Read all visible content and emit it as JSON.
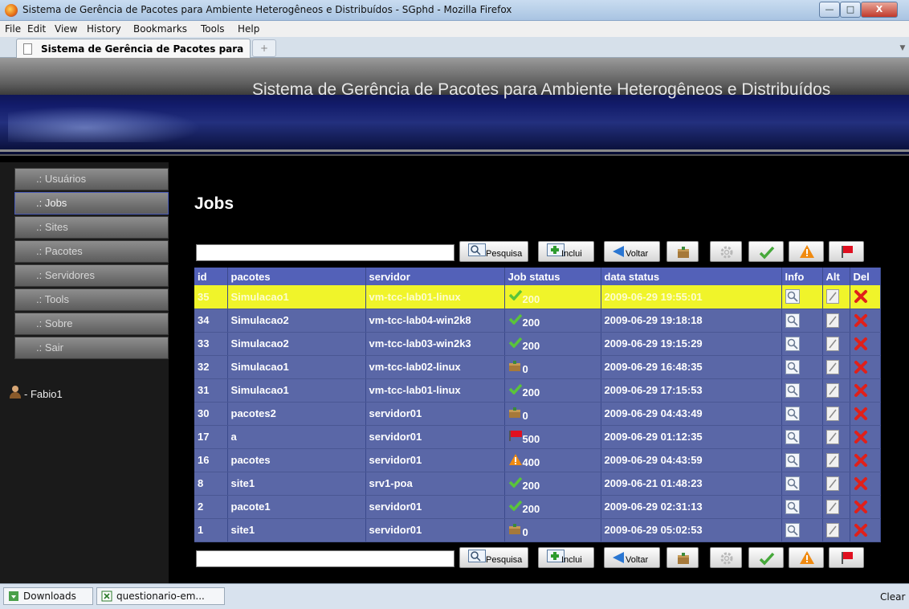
{
  "window": {
    "title": "Sistema de Gerência de Pacotes para Ambiente Heterogêneos e Distribuídos - SGphd - Mozilla Firefox"
  },
  "menu": [
    "File",
    "Edit",
    "View",
    "History",
    "Bookmarks",
    "Tools",
    "Help"
  ],
  "tab": {
    "label": "Sistema de Gerência de Pacotes para ..."
  },
  "site": {
    "title": "Sistema de Gerência de Pacotes para Ambiente Heterogêneos e Distribuídos"
  },
  "sidebar": {
    "items": [
      {
        "label": ".: Usuários"
      },
      {
        "label": ".: Jobs"
      },
      {
        "label": ".: Sites"
      },
      {
        "label": ".: Pacotes"
      },
      {
        "label": ".: Servidores"
      },
      {
        "label": ".: Tools"
      },
      {
        "label": ".: Sobre"
      },
      {
        "label": ".: Sair"
      }
    ],
    "active": ".: Jobs",
    "user": "- Fabio1"
  },
  "main": {
    "heading": "Jobs",
    "toolbar": {
      "search_value": "",
      "pesquisa": "Pesquisa",
      "inclui": "Inclui",
      "voltar": "Voltar"
    },
    "table": {
      "headers": [
        "id",
        "pacotes",
        "servidor",
        "Job status",
        "data status",
        "Info",
        "Alt",
        "Del"
      ],
      "rows": [
        {
          "id": "35",
          "pacote": "Simulacao1",
          "servidor": "vm-tcc-lab01-linux",
          "status_icon": "check-icon",
          "status": "200",
          "data": "2009-06-29 19:55:01"
        },
        {
          "id": "34",
          "pacote": "Simulacao2",
          "servidor": "vm-tcc-lab04-win2k8",
          "status_icon": "check-icon",
          "status": "200",
          "data": "2009-06-29 19:18:18"
        },
        {
          "id": "33",
          "pacote": "Simulacao2",
          "servidor": "vm-tcc-lab03-win2k3",
          "status_icon": "check-icon",
          "status": "200",
          "data": "2009-06-29 19:15:29"
        },
        {
          "id": "32",
          "pacote": "Simulacao1",
          "servidor": "vm-tcc-lab02-linux",
          "status_icon": "package-icon",
          "status": "0",
          "data": "2009-06-29 16:48:35"
        },
        {
          "id": "31",
          "pacote": "Simulacao1",
          "servidor": "vm-tcc-lab01-linux",
          "status_icon": "check-icon",
          "status": "200",
          "data": "2009-06-29 17:15:53"
        },
        {
          "id": "30",
          "pacote": "pacotes2",
          "servidor": "servidor01",
          "status_icon": "package-icon",
          "status": "0",
          "data": "2009-06-29 04:43:49"
        },
        {
          "id": "17",
          "pacote": "a",
          "servidor": "servidor01",
          "status_icon": "flag-icon",
          "status": "500",
          "data": "2009-06-29 01:12:35"
        },
        {
          "id": "16",
          "pacote": "pacotes",
          "servidor": "servidor01",
          "status_icon": "warning-icon",
          "status": "400",
          "data": "2009-06-29 04:43:59"
        },
        {
          "id": "8",
          "pacote": "site1",
          "servidor": "srv1-poa",
          "status_icon": "check-icon",
          "status": "200",
          "data": "2009-06-21 01:48:23"
        },
        {
          "id": "2",
          "pacote": "pacote1",
          "servidor": "servidor01",
          "status_icon": "check-icon",
          "status": "200",
          "data": "2009-06-29 02:31:13"
        },
        {
          "id": "1",
          "pacote": "site1",
          "servidor": "servidor01",
          "status_icon": "package-icon",
          "status": "0",
          "data": "2009-06-29 05:02:53"
        }
      ],
      "highlight_color": "#f0f42a",
      "row_color": "#5a67a7",
      "header_color": "#5361b8"
    }
  },
  "statusbar": {
    "downloads": "Downloads",
    "file": "questionario-em...",
    "clear": "Clear"
  }
}
